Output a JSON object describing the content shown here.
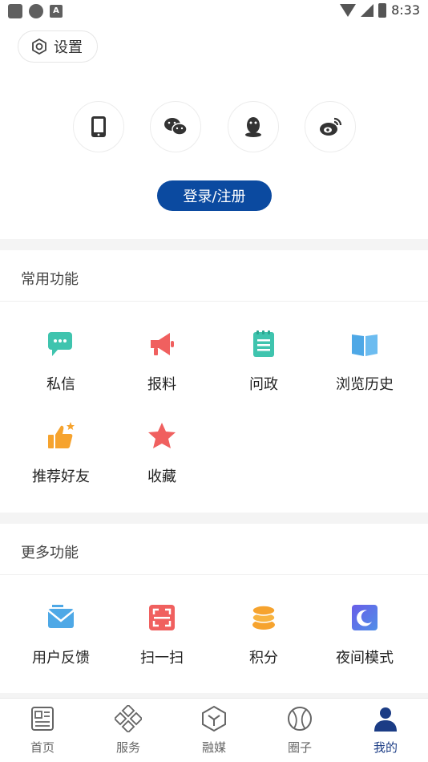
{
  "status_bar": {
    "time": "8:33",
    "a_badge": "A"
  },
  "settings": {
    "label": "设置"
  },
  "social_login": [
    {
      "icon": "phone-icon"
    },
    {
      "icon": "wechat-icon"
    },
    {
      "icon": "qq-icon"
    },
    {
      "icon": "weibo-icon"
    }
  ],
  "login_button": {
    "label": "登录/注册",
    "color": "#0b4aa0"
  },
  "common_features": {
    "title": "常用功能",
    "items": [
      {
        "label": "私信",
        "icon": "message-icon"
      },
      {
        "label": "报料",
        "icon": "megaphone-icon"
      },
      {
        "label": "问政",
        "icon": "notepad-icon"
      },
      {
        "label": "浏览历史",
        "icon": "book-icon"
      },
      {
        "label": "推荐好友",
        "icon": "thumbs-up-icon"
      },
      {
        "label": "收藏",
        "icon": "star-icon"
      }
    ]
  },
  "more_features": {
    "title": "更多功能",
    "items": [
      {
        "label": "用户反馈",
        "icon": "mail-icon"
      },
      {
        "label": "扫一扫",
        "icon": "scan-icon"
      },
      {
        "label": "积分",
        "icon": "coins-icon"
      },
      {
        "label": "夜间模式",
        "icon": "moon-icon"
      }
    ]
  },
  "tab_bar": {
    "active": "我的",
    "active_color": "#1b3c85",
    "tabs": [
      {
        "label": "首页",
        "icon": "news-icon"
      },
      {
        "label": "服务",
        "icon": "service-icon"
      },
      {
        "label": "融媒",
        "icon": "media-cube-icon"
      },
      {
        "label": "圈子",
        "icon": "circle-icon"
      },
      {
        "label": "我的",
        "icon": "profile-icon"
      }
    ]
  }
}
